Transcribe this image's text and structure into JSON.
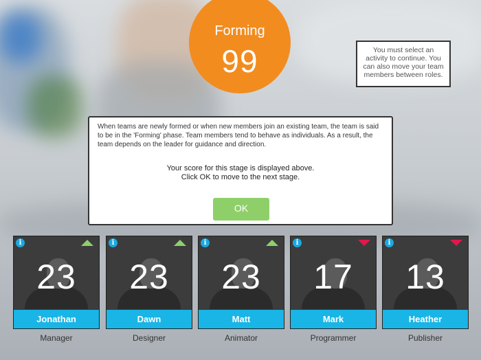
{
  "stage": {
    "name": "Forming",
    "score": "99"
  },
  "hint": "You must select an activity to continue. You can also move your team members between roles.",
  "dialog": {
    "body": "When teams are newly formed or when new members join an existing team, the team is said to be in the 'Forming' phase. Team members tend to behave as individuals. As a result, the team depends on the leader for guidance and direction.",
    "score_line1": "Your score for this stage is displayed above.",
    "score_line2": "Click OK to move to the next stage.",
    "ok_label": "OK"
  },
  "team": [
    {
      "name": "Jonathan",
      "role": "Manager",
      "value": "23",
      "trend": "up"
    },
    {
      "name": "Dawn",
      "role": "Designer",
      "value": "23",
      "trend": "up"
    },
    {
      "name": "Matt",
      "role": "Animator",
      "value": "23",
      "trend": "up"
    },
    {
      "name": "Mark",
      "role": "Programmer",
      "value": "17",
      "trend": "down"
    },
    {
      "name": "Heather",
      "role": "Publisher",
      "value": "13",
      "trend": "down"
    }
  ],
  "colors": {
    "accent": "#f28c1e",
    "name_bar": "#19b5e6",
    "ok_button": "#8fcf6a",
    "trend_up": "#8fcf6a",
    "trend_down": "#e0184a"
  },
  "info_icon_glyph": "i"
}
